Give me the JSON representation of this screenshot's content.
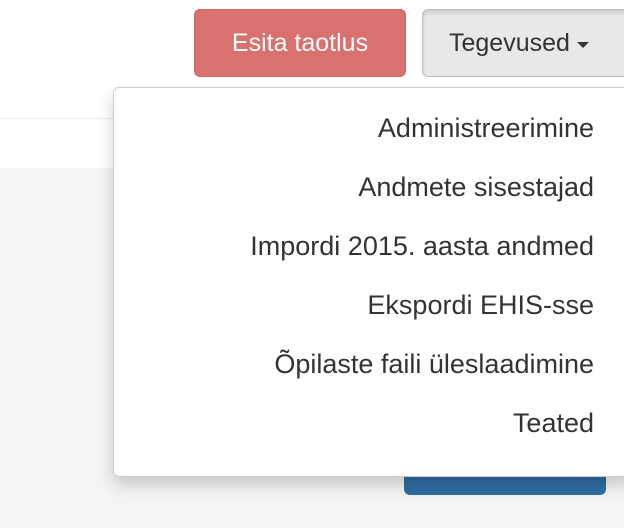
{
  "toolbar": {
    "submit_label": "Esita taotlus",
    "actions_label": "Tegevused",
    "actions_icon": "caret-down-icon",
    "submit_color": "#d9726f",
    "actions_bg": "#e8e8e8"
  },
  "dropdown": {
    "items": [
      {
        "label": "Administreerimine"
      },
      {
        "label": "Andmete sisestajad"
      },
      {
        "label": "Impordi 2015. aasta andmed"
      },
      {
        "label": "Ekspordi EHIS-sse"
      },
      {
        "label": "Õpilaste faili üleslaadimine"
      },
      {
        "label": "Teated"
      }
    ]
  }
}
